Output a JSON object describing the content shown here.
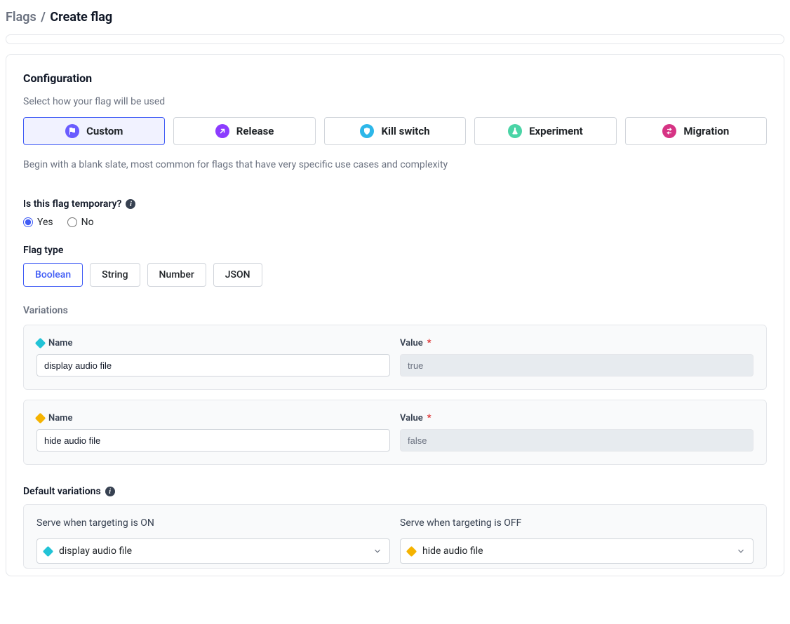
{
  "breadcrumb": {
    "parent": "Flags",
    "current": "Create flag"
  },
  "configuration": {
    "title": "Configuration",
    "hint": "Select how your flag will be used",
    "templates": [
      {
        "key": "custom",
        "label": "Custom",
        "color": "#6a5cff"
      },
      {
        "key": "release",
        "label": "Release",
        "color": "#8c3cff"
      },
      {
        "key": "killswitch",
        "label": "Kill switch",
        "color": "#2db7e9"
      },
      {
        "key": "experiment",
        "label": "Experiment",
        "color": "#4ad4a6"
      },
      {
        "key": "migration",
        "label": "Migration",
        "color": "#d63384"
      }
    ],
    "selected_template": "custom",
    "description": "Begin with a blank slate, most common for flags that have very specific use cases and complexity"
  },
  "temporary": {
    "label": "Is this flag temporary?",
    "options": {
      "yes": "Yes",
      "no": "No"
    },
    "value": "yes"
  },
  "flag_type": {
    "label": "Flag type",
    "options": [
      "Boolean",
      "String",
      "Number",
      "JSON"
    ],
    "value": "Boolean"
  },
  "variations": {
    "heading": "Variations",
    "name_label": "Name",
    "value_label": "Value",
    "items": [
      {
        "color": "teal",
        "name": "display audio file",
        "value": "true"
      },
      {
        "color": "amber",
        "name": "hide audio file",
        "value": "false"
      }
    ]
  },
  "defaults": {
    "heading": "Default variations",
    "on_label": "Serve when targeting is ON",
    "off_label": "Serve when targeting is OFF",
    "on": {
      "color": "teal",
      "label": "display audio file"
    },
    "off": {
      "color": "amber",
      "label": "hide audio file"
    }
  }
}
